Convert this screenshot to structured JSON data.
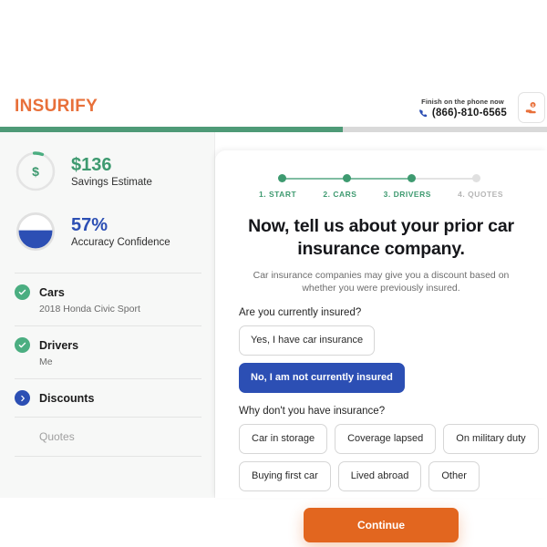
{
  "header": {
    "logo_text": "INSURIFY",
    "logo_color": "#E8703A",
    "phone_label": "Finish on the phone now",
    "phone_number": "(866)-810-6565",
    "phone_icon": "phone-icon",
    "hand_icon": "hand-money-icon"
  },
  "progress": {
    "percent": 63,
    "fill_color": "#4E9A77",
    "track_color": "#D9D9D9"
  },
  "sidebar": {
    "meters": [
      {
        "value": "$136",
        "label": "Savings Estimate",
        "icon": "dollar-icon",
        "color": "#3E9A70",
        "fill_percent": 8,
        "style": "ring"
      },
      {
        "value": "57%",
        "label": "Accuracy Confidence",
        "icon": "confidence-gauge-icon",
        "color": "#2C4FB4",
        "fill_percent": 57,
        "style": "liquid"
      }
    ],
    "items": [
      {
        "title": "Cars",
        "subtitle": "2018 Honda Civic Sport",
        "state": "done",
        "icon": "check-circle-icon"
      },
      {
        "title": "Drivers",
        "subtitle": "Me",
        "state": "done",
        "icon": "check-circle-icon"
      },
      {
        "title": "Discounts",
        "subtitle": "",
        "state": "active",
        "icon": "chevron-right-circle-icon"
      },
      {
        "title": "Quotes",
        "subtitle": "",
        "state": "todo",
        "icon": ""
      }
    ]
  },
  "main": {
    "steps": [
      {
        "label": "1. START",
        "state": "done"
      },
      {
        "label": "2. CARS",
        "state": "done"
      },
      {
        "label": "3. DRIVERS",
        "state": "done"
      },
      {
        "label": "4. QUOTES",
        "state": "todo"
      }
    ],
    "headline": "Now, tell us about your prior car insurance company.",
    "subhead": "Car insurance companies may give you a discount based on whether you were previously insured.",
    "question_insured": {
      "prompt": "Are you currently insured?",
      "options": [
        {
          "label": "Yes, I have car insurance",
          "selected": false
        },
        {
          "label": "No, I am not currently insured",
          "selected": true
        }
      ]
    },
    "question_reason": {
      "prompt": "Why don't you have insurance?",
      "options": [
        {
          "label": "Car in storage",
          "selected": false
        },
        {
          "label": "Coverage lapsed",
          "selected": false
        },
        {
          "label": "On military duty",
          "selected": false
        },
        {
          "label": "Buying first car",
          "selected": false
        },
        {
          "label": "Lived abroad",
          "selected": false
        },
        {
          "label": "Other",
          "selected": false
        }
      ]
    },
    "continue_label": "Continue",
    "continue_color": "#E2661F"
  }
}
